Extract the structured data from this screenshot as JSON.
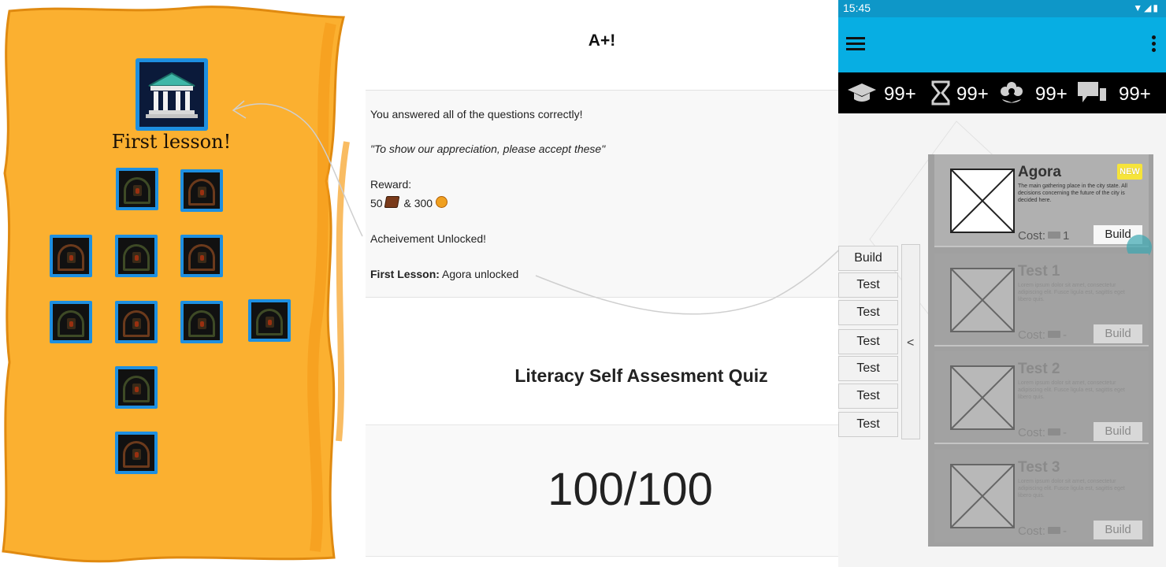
{
  "achievements": {
    "title": "First lesson!",
    "unlocked_icon": "temple-icon",
    "locked_icon": "locked-gate-icon"
  },
  "lesson": {
    "grade": "A+!",
    "message": "You answered all of the questions correctly!",
    "quote": "\"To show our appreciation, please accept these\"",
    "reward_label": "Reward:",
    "reward_books": "50",
    "reward_sep": "& 300",
    "achievement_header": "Acheivement Unlocked!",
    "achievement_name": "First Lesson:",
    "achievement_detail": "Agora unlocked",
    "quiz_title": "Literacy Self Assesment Quiz",
    "score": "100/100"
  },
  "phone": {
    "time": "15:45",
    "resources": [
      {
        "icon": "graduation-cap-icon",
        "value": "99+"
      },
      {
        "icon": "hourglass-icon",
        "value": "99+"
      },
      {
        "icon": "flower-icon",
        "value": "99+"
      },
      {
        "icon": "chat-icon",
        "value": "99+"
      }
    ],
    "side_menu": [
      "Build",
      "Test",
      "Test",
      "Test",
      "Test",
      "Test",
      "Test"
    ],
    "buildings": [
      {
        "name": "Agora",
        "badge": "NEW",
        "desc": "The main gathering place in the city state. All decisions concerning the future of the city is decided here.",
        "cost_label": "Cost:",
        "cost_value": "1",
        "button": "Build"
      },
      {
        "name": "Test 1",
        "desc": "Lorem ipsum dolor sit amet, consectetur adipiscing elit. Fusce ligula est, sagittis eget libero quis.",
        "cost_label": "Cost:",
        "cost_value": "-",
        "button": "Build"
      },
      {
        "name": "Test 2",
        "desc": "Lorem ipsum dolor sit amet, consectetur adipiscing elit. Fusce ligula est, sagittis eget libero quis.",
        "cost_label": "Cost:",
        "cost_value": "-",
        "button": "Build"
      },
      {
        "name": "Test 3",
        "desc": "Lorem ipsum dolor sit amet, consectetur adipiscing elit. Fusce ligula est, sagittis eget libero quis.",
        "cost_label": "Cost:",
        "cost_value": "-",
        "button": "Build"
      }
    ],
    "colors": {
      "status_bar": "#0e97c8",
      "app_bar": "#07aee3",
      "resource_bar": "#000000"
    }
  }
}
